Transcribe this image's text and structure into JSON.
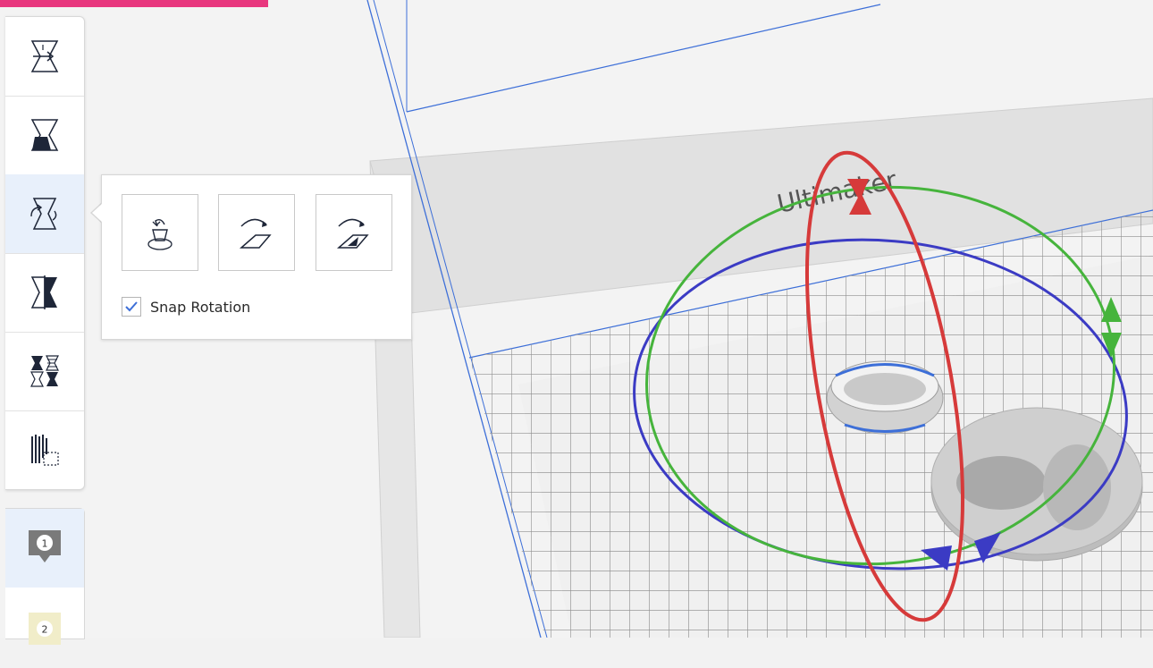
{
  "accent_color": "#e8377e",
  "viewport": {
    "brand_text": "Ultimaker",
    "gizmo_colors": {
      "x": "#d63a3a",
      "y": "#3aa83a",
      "z": "#3b3bc4"
    }
  },
  "toolbar": {
    "tools": [
      {
        "name": "move-tool",
        "icon": "move-icon"
      },
      {
        "name": "scale-tool",
        "icon": "scale-icon"
      },
      {
        "name": "rotate-tool",
        "icon": "rotate-icon",
        "active": true
      },
      {
        "name": "mirror-tool",
        "icon": "mirror-icon"
      },
      {
        "name": "per-model-settings-tool",
        "icon": "per-model-settings-icon"
      },
      {
        "name": "support-blocker-tool",
        "icon": "support-blocker-icon"
      }
    ]
  },
  "rotate_panel": {
    "buttons": [
      {
        "name": "reset-rotation",
        "icon": "reset-rotation-icon"
      },
      {
        "name": "lay-flat",
        "icon": "lay-flat-icon"
      },
      {
        "name": "select-face-to-align",
        "icon": "align-face-icon"
      }
    ],
    "snap_rotation_label": "Snap Rotation",
    "snap_rotation_checked": true
  },
  "object_list": {
    "items": [
      {
        "label": "1",
        "color": "#7a7a7a"
      },
      {
        "label": "2",
        "color": "#f1edc9"
      }
    ]
  }
}
